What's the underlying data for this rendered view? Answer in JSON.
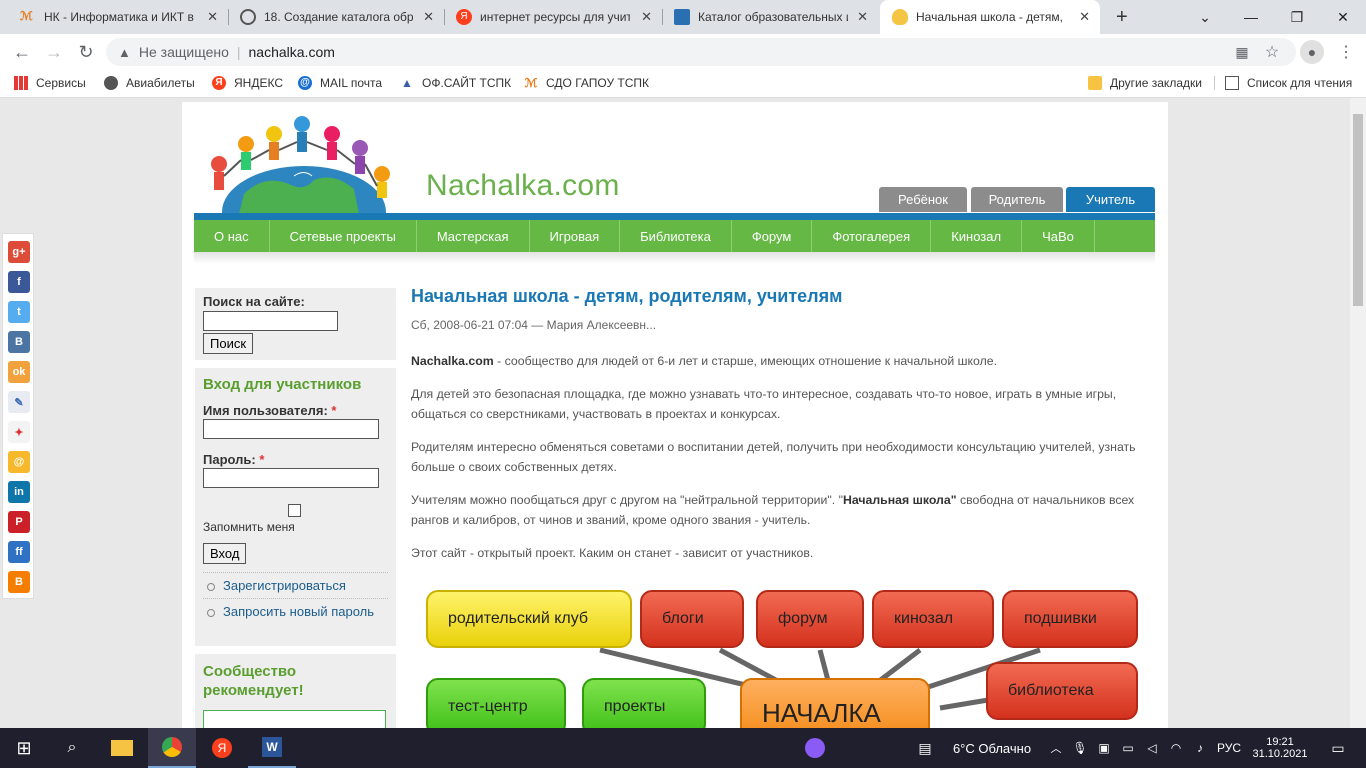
{
  "browser": {
    "tabs": [
      {
        "title": "НК - Информатика и ИКТ в",
        "favicon": "tm-icon"
      },
      {
        "title": "18. Создание каталога обра",
        "favicon": "globe-icon"
      },
      {
        "title": "интернет ресурсы для учите",
        "favicon": "yandex-icon"
      },
      {
        "title": "Каталог образовательных и",
        "favicon": "book-icon"
      },
      {
        "title": "Начальная школа - детям, р",
        "favicon": "nachalka-icon"
      }
    ],
    "new_tab": "+",
    "security_label": "Не защищено",
    "url": "nachalka.com",
    "bookmarks": [
      {
        "label": "Сервисы",
        "icon": "apps-grid-icon"
      },
      {
        "label": "Авиабилеты",
        "icon": "globe-icon"
      },
      {
        "label": "ЯНДЕКС",
        "icon": "yandex-icon"
      },
      {
        "label": "MAIL почта",
        "icon": "mail-icon"
      },
      {
        "label": "ОФ.САЙТ ТСПК",
        "icon": "triangle-icon"
      },
      {
        "label": "СДО ГАПОУ ТСПК",
        "icon": "tm-icon"
      }
    ],
    "other_bookmarks": "Другие закладки",
    "reading_list": "Список для чтения"
  },
  "site": {
    "name": "Nachalka.com",
    "roles": [
      "Ребёнок",
      "Родитель",
      "Учитель"
    ],
    "nav": [
      "О нас",
      "Сетевые проекты",
      "Мастерская",
      "Игровая",
      "Библиотека",
      "Форум",
      "Фотогалерея",
      "Кинозал",
      "ЧаВо"
    ]
  },
  "sidebar": {
    "search_label": "Поиск на сайте:",
    "search_button": "Поиск",
    "login_title": "Вход для участников",
    "username_label": "Имя пользователя:",
    "password_label": "Пароль:",
    "required_mark": "*",
    "remember_label": "Запомнить меня",
    "login_button": "Вход",
    "links": [
      "Зарегистрироваться",
      "Запросить новый пароль"
    ],
    "community_title": "Сообщество рекомендует!"
  },
  "article": {
    "title": "Начальная школа - детям, родителям, учителям",
    "meta": "Сб, 2008-06-21 07:04 — Мария Алексеевн...",
    "p1_bold": "Nachalka.com",
    "p1_rest": " - сообщество для людей от 6-и лет и старше, имеющих отношение к начальной школе.",
    "p2": "Для детей это безопасная площадка, где можно узнавать что-то интересное, создавать что-то новое, играть в умные игры, общаться со сверстниками, участвовать в проектах и конкурсах.",
    "p3": "Родителям интересно обменяться советами о воспитании детей, получить при необходимости консультацию учителей, узнать больше о своих собственных детях.",
    "p4_a": "Учителям можно пообщаться друг с другом на \"нейтральной территории\". \"",
    "p4_bold": "Начальная школа\"",
    "p4_b": "  свободна от начальников всех рангов и калибров, от чинов и званий, кроме одного звания - учитель.",
    "p5": "Этот сайт - открытый проект. Каким он станет - зависит от участников.",
    "cloud": [
      "родительский клуб",
      "блоги",
      "форум",
      "кинозал",
      "подшивки",
      "тест-центр",
      "проекты",
      "НАЧАЛКА",
      "библиотека"
    ]
  },
  "share_icons": [
    "google-plus-icon",
    "facebook-icon",
    "twitter-icon",
    "vk-icon",
    "odnoklassniki-icon",
    "livejournal-icon",
    "moikrug-icon",
    "mailru-icon",
    "linkedin-icon",
    "pinterest-icon",
    "friendfeed-icon",
    "blogger-icon"
  ],
  "taskbar": {
    "weather": "6°C  Облачно",
    "lang": "РУС",
    "time": "19:21",
    "date": "31.10.2021"
  },
  "colors": {
    "green": "#64b843",
    "blue": "#1a78b5",
    "gray_tab": "#8c8c8c"
  }
}
